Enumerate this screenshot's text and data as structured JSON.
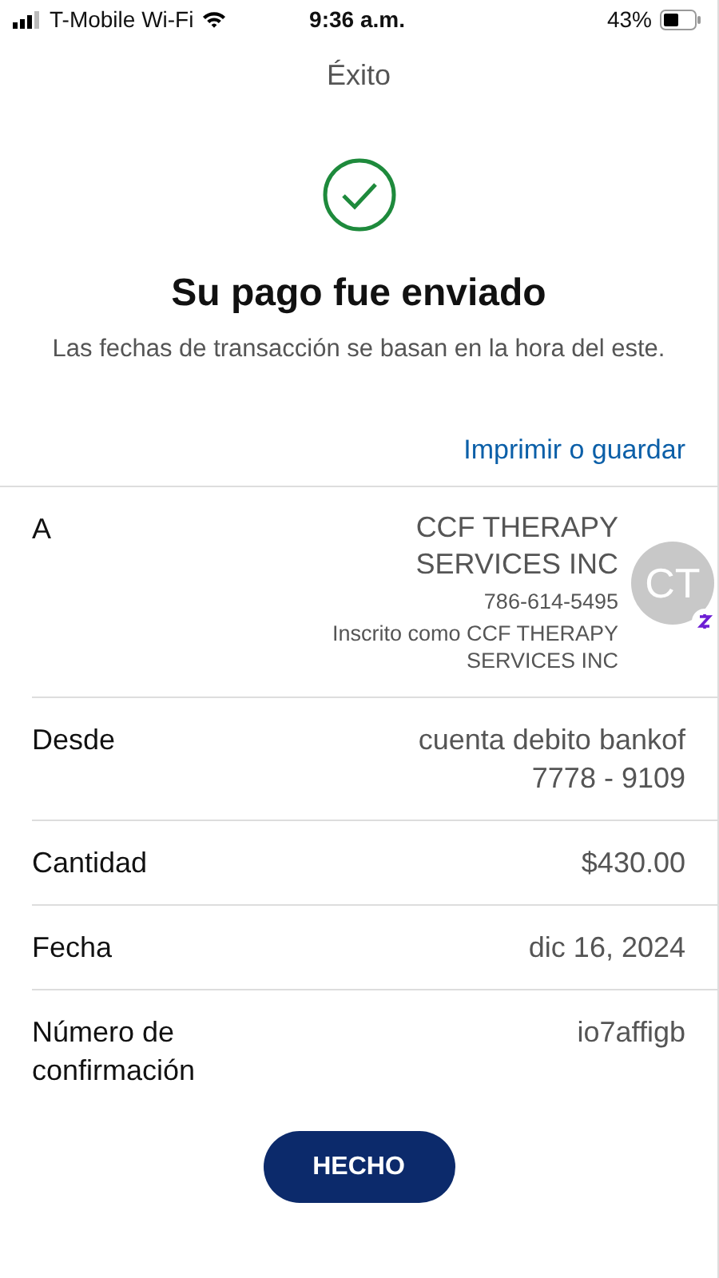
{
  "status_bar": {
    "carrier": "T-Mobile Wi-Fi",
    "time": "9:36 a.m.",
    "battery": "43%"
  },
  "header": {
    "title": "Éxito"
  },
  "result": {
    "heading": "Su pago fue enviado",
    "note": "Las fechas de transacción se basan en la hora del este."
  },
  "print_link": "Imprimir o guardar",
  "details": [
    {
      "kind": "recipient",
      "label": "A",
      "name_lines": [
        "CCF THERAPY",
        "SERVICES INC"
      ],
      "phone": "786-614-5495",
      "enrolled_lines": [
        "Inscrito como CCF THERAPY",
        "SERVICES INC"
      ],
      "initials": "CT"
    },
    {
      "kind": "plain",
      "label": "Desde",
      "value_lines": [
        "cuenta debito bankof",
        "7778 - 9109"
      ]
    },
    {
      "kind": "plain",
      "label": "Cantidad",
      "value_lines": [
        "$430.00"
      ]
    },
    {
      "kind": "plain",
      "label": "Fecha",
      "value_lines": [
        "dic 16, 2024"
      ]
    },
    {
      "kind": "plain",
      "label": "Número de confirmación",
      "value_lines": [
        "io7affigb"
      ]
    }
  ],
  "done_button": "HECHO"
}
